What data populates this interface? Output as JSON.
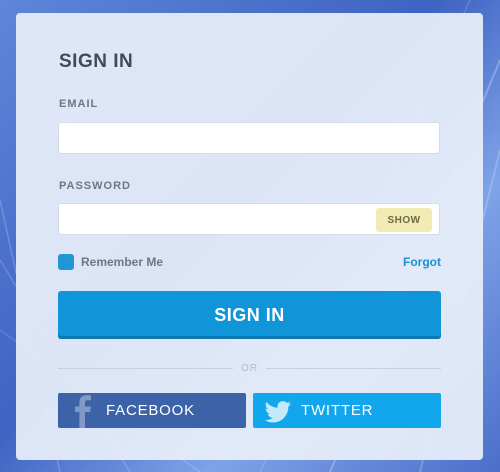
{
  "form": {
    "title": "SIGN IN",
    "email_label": "EMAIL",
    "email_value": "",
    "password_label": "PASSWORD",
    "password_value": "",
    "show_label": "SHOW",
    "remember_label": "Remember Me",
    "remember_checked": true,
    "forgot_label": "Forgot",
    "submit_label": "SIGN IN",
    "divider_label": "OR"
  },
  "social": {
    "facebook_label": "FACEBOOK",
    "twitter_label": "TWITTER"
  },
  "colors": {
    "primary": "#0f95d8",
    "facebook": "#3c63a8",
    "twitter": "#12a7ec",
    "show_button": "#f1ebb4"
  },
  "icons": {
    "facebook": "facebook-icon",
    "twitter": "twitter-icon",
    "checkbox": "checkbox-checked"
  }
}
